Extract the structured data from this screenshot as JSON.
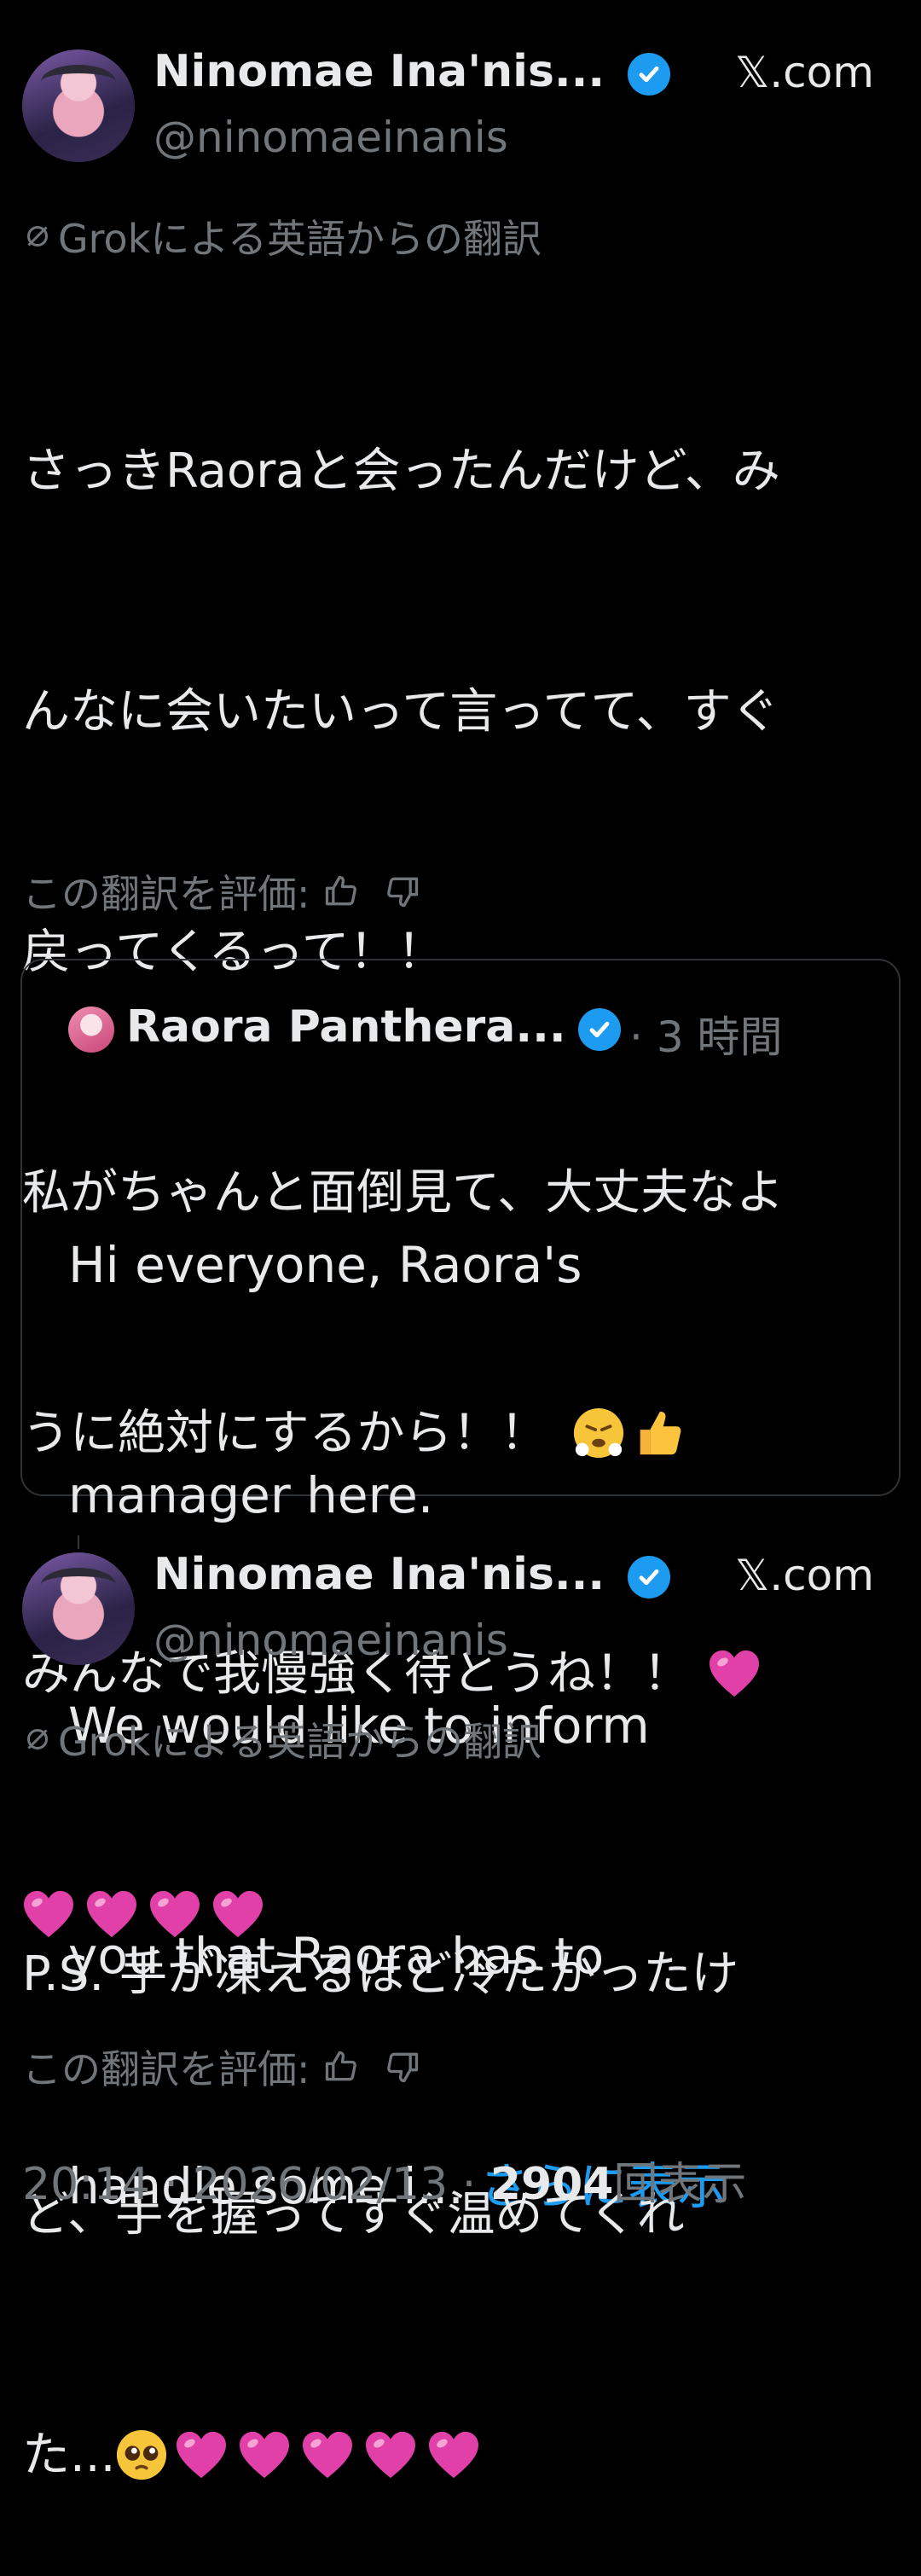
{
  "tweet1": {
    "name": "Ninomae Ina'nis...",
    "handle": "@ninomaeinanis",
    "source": "𝕏.com",
    "translation_label": "Grokによる英語からの翻訳",
    "line1": "さっきRaoraと会ったんだけど、み",
    "line2": "んなに会いたいって言ってて、すぐ",
    "line3": "戻ってくるって！！",
    "line4": "私がちゃんと面倒見て、大丈夫なよ",
    "line5": "うに絶対にするから！！",
    "line6": "みんなで我慢強く待とうね！！",
    "rate_label": "この翻訳を評価:"
  },
  "quote": {
    "name": "Raora Panthera...",
    "separator": "·",
    "time": "3 時間",
    "line1": "Hi everyone, Raora's",
    "line2": "manager here.",
    "line3": "We would like to inform",
    "line4": "you that Raora has to",
    "line5": "handle some i...",
    "more": "さらに表示"
  },
  "tweet2": {
    "name": "Ninomae Ina'nis...",
    "handle": "@ninomaeinanis",
    "source": "𝕏.com",
    "translation_label": "Grokによる英語からの翻訳",
    "line1": "P.S. 手が凍えるほど冷たかったけ",
    "line2": "ど、手を握ってすぐ温めてくれ",
    "line3": "た...",
    "rate_label": "この翻訳を評価:"
  },
  "meta": {
    "time": "20:14",
    "sep1": "·",
    "date": "2026/02/13",
    "sep2": "·",
    "views": "2904",
    "views_label": "回表示"
  },
  "colors": {
    "accent": "#1d9bf0",
    "heart": "#e040a8",
    "muted": "#71767b"
  },
  "icons": [
    "verified-badge-icon",
    "grok-slash-icon",
    "thumbs-up-icon",
    "thumbs-down-icon",
    "pink-heart-icon",
    "huffing-face-icon",
    "thumbs-up-emoji-icon",
    "pleading-face-icon"
  ]
}
